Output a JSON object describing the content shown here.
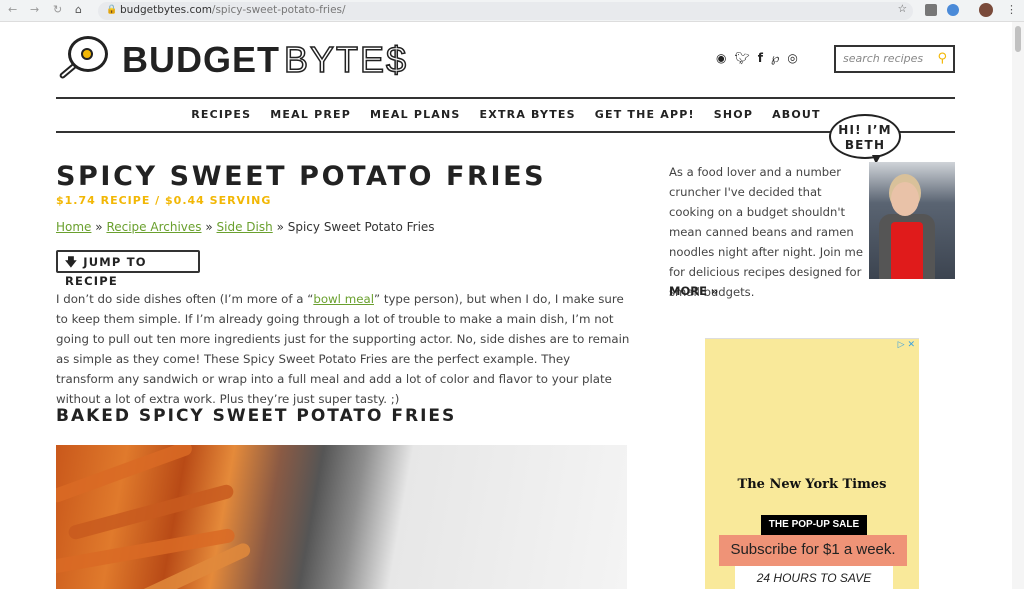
{
  "browser": {
    "url_domain": "budgetbytes.com",
    "url_path": "/spicy-sweet-potato-fries/",
    "back_icon": "arrow-left",
    "forward_icon": "arrow-right",
    "reload_icon": "reload",
    "home_icon": "home",
    "bookmark_icon": "star"
  },
  "header": {
    "logo_bold": "BUDGET",
    "logo_outline": "BYTE$",
    "social": [
      "rss",
      "twitter",
      "facebook",
      "pinterest",
      "instagram"
    ],
    "search_placeholder": "search recipes"
  },
  "nav": {
    "items": [
      {
        "label": "RECIPES"
      },
      {
        "label": "MEAL PREP"
      },
      {
        "label": "MEAL PLANS"
      },
      {
        "label": "EXTRA BYTES"
      },
      {
        "label": "GET THE APP!"
      },
      {
        "label": "SHOP"
      },
      {
        "label": "ABOUT"
      }
    ]
  },
  "post": {
    "title": "SPICY SWEET POTATO FRIES",
    "price": "$1.74 RECIPE / $0.44 SERVING",
    "breadcrumb": {
      "home": "Home",
      "sep": "»",
      "archives": "Recipe Archives",
      "category": "Side Dish",
      "current": "Spicy Sweet Potato Fries"
    },
    "jump_label": "JUMP TO RECIPE",
    "intro_before": "I don’t do side dishes often (I’m more of a “",
    "intro_link": "bowl meal",
    "intro_after": "” type person), but when I do, I make sure to keep them simple. If I’m already going through a lot of trouble to make a main dish, I’m not going to pull out ten more ingredients just for the supporting actor. No, side dishes are to remain as simple as they come! These Spicy Sweet Potato Fries are the perfect example. They transform any sandwich or wrap into a full meal and add a lot of color and flavor to your plate without a lot of extra work. Plus they’re just super tasty. ;)",
    "subheading": "BAKED SPICY SWEET POTATO FRIES"
  },
  "sidebar": {
    "bubble": "HI! I’M BETH",
    "about": "As a food lover and a number cruncher I've decided that cooking on a budget shouldn't mean canned beans and ramen noodles night after night. Join me for delicious recipes designed for small budgets.",
    "more": "MORE »"
  },
  "ad": {
    "brand": "The New York Times",
    "tag": "THE POP-UP SALE",
    "offer": "Subscribe for $1 a week.",
    "urgency": "24 HOURS TO SAVE",
    "bg_color": "#f9e99a"
  },
  "colors": {
    "accent": "#f2b705",
    "link": "#6aa02e"
  }
}
